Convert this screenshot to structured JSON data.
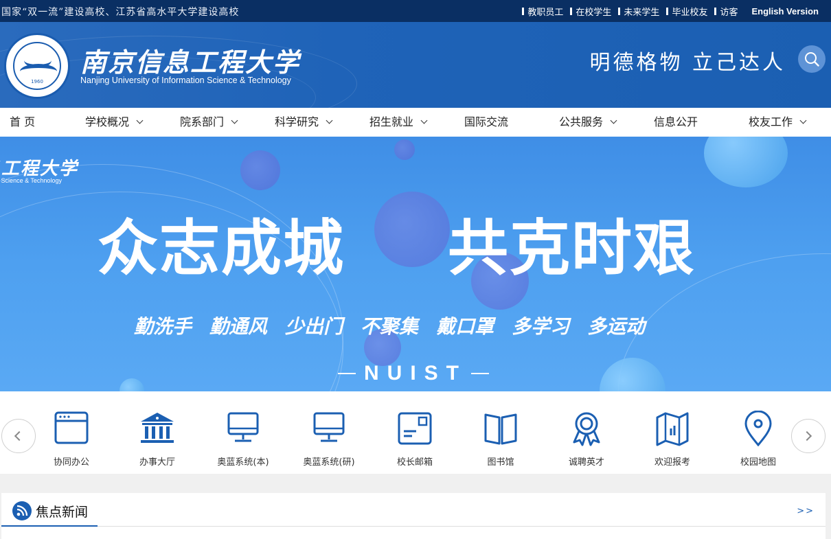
{
  "topbar": {
    "slogan": "国家“双一流”建设高校、江苏省高水平大学建设高校",
    "links": [
      "教职员工",
      "在校学生",
      "未来学生",
      "毕业校友",
      "访客"
    ],
    "english": "English Version"
  },
  "header": {
    "name_cn": "南京信息工程大学",
    "name_en": "Nanjing University of Information Science & Technology",
    "seal_year": "1960",
    "motto": "明德格物 立己达人"
  },
  "nav": [
    "首 页",
    "学校概况",
    "院系部门",
    "科学研究",
    "招生就业",
    "国际交流",
    "公共服务",
    "信息公开",
    "校友工作"
  ],
  "banner": {
    "logo_cn": "南京信息工程大学",
    "logo_en": "Nanjing University of Information Science & Technology",
    "headline_left": "众志成城",
    "headline_right": "共克时艰",
    "tips": [
      "勤洗手",
      "勤通风",
      "少出门",
      "不聚集",
      "戴口罩",
      "多学习",
      "多运动"
    ],
    "tag": "NUIST"
  },
  "quick_links": [
    "协同办公",
    "办事大厅",
    "奥蓝系统(本)",
    "奥蓝系统(研)",
    "校长邮箱",
    "图书馆",
    "诚聘英才",
    "欢迎报考",
    "校园地图"
  ],
  "news": {
    "title": "焦点新闻",
    "more": ">>"
  },
  "colors": {
    "topbar": "#0a2f63",
    "brand": "#1b5fb2",
    "banner": "#4ea0f0"
  }
}
